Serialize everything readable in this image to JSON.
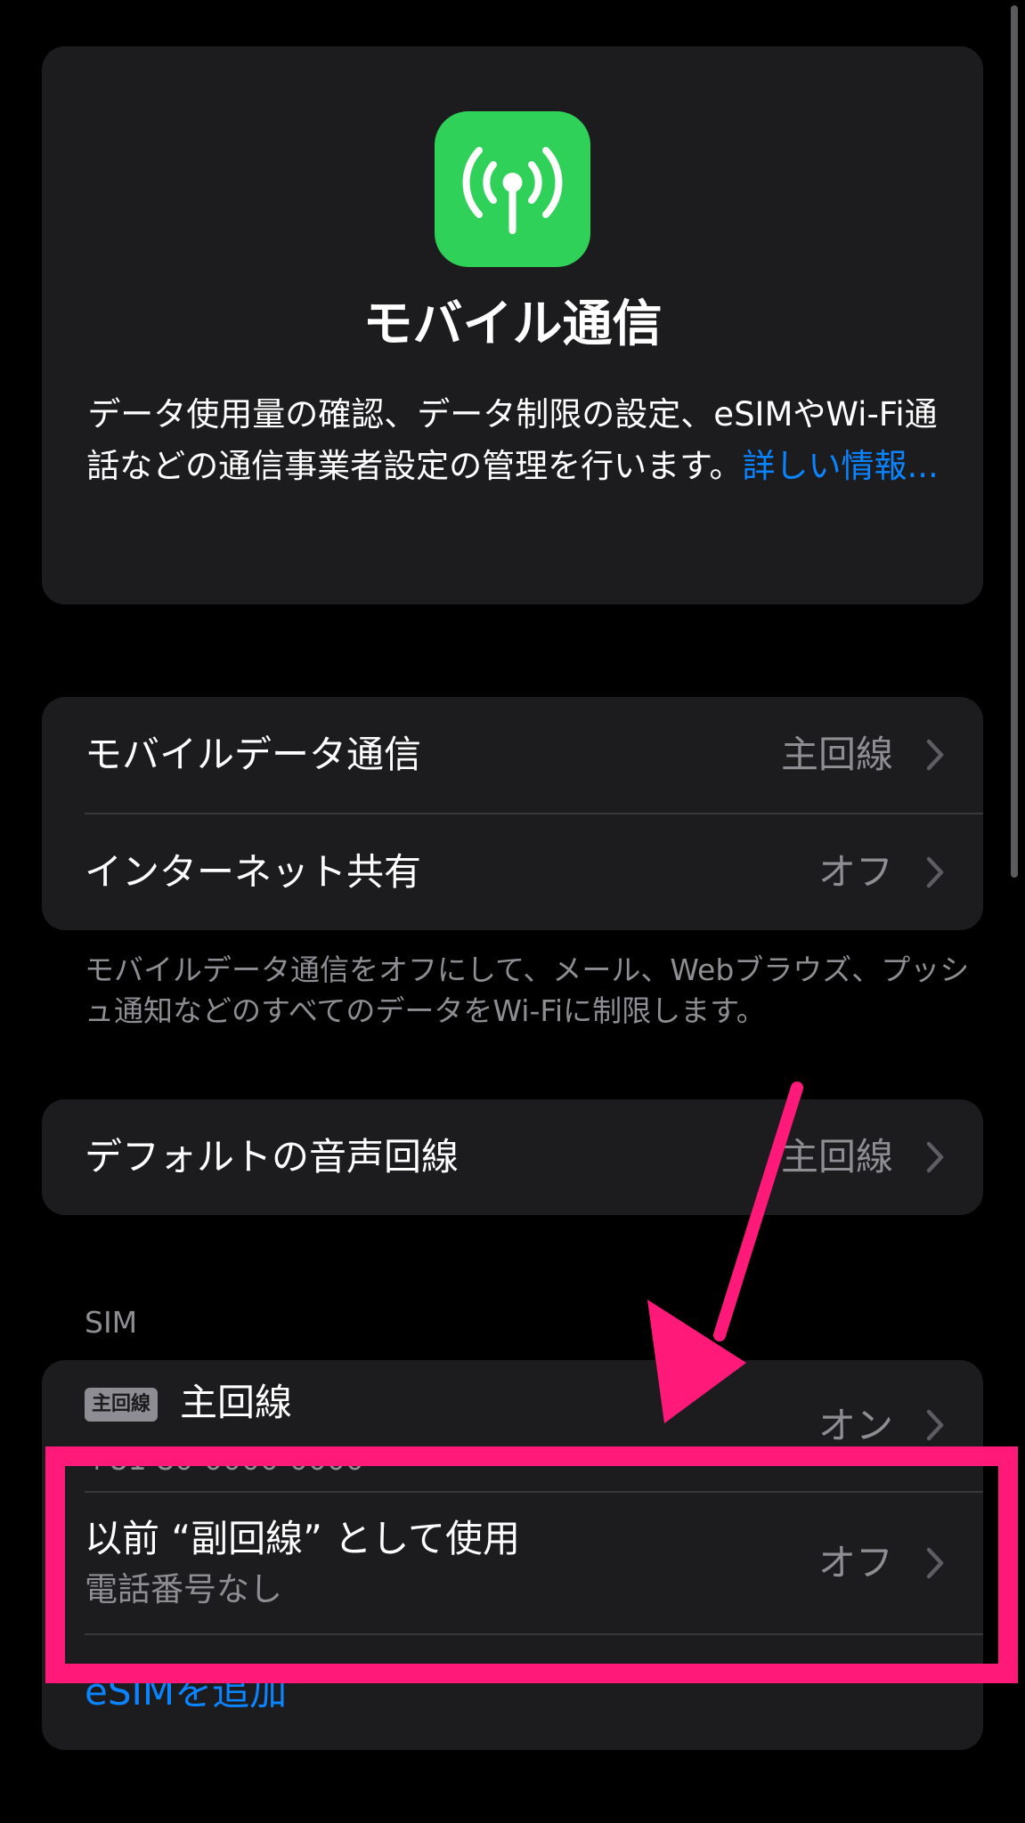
{
  "hero": {
    "icon": "antenna-icon",
    "icon_color": "#30d158",
    "title": "モバイル通信",
    "description": "データ使用量の確認、データ制限の設定、eSIMやWi-Fi通話などの通信事業者設定の管理を行います。",
    "link": "詳しい情報..."
  },
  "data_section": {
    "rows": [
      {
        "label": "モバイルデータ通信",
        "value": "主回線"
      },
      {
        "label": "インターネット共有",
        "value": "オフ"
      }
    ],
    "footer": "モバイルデータ通信をオフにして、メール、Webブラウズ、プッシュ通知などのすべてのデータをWi-Fiに制限します。"
  },
  "voice_section": {
    "label": "デフォルトの音声回線",
    "value": "主回線"
  },
  "sim_section": {
    "header": "SIM",
    "primary": {
      "badge": "主回線",
      "name": "主回線",
      "number": "+81 80-0000-0000",
      "value": "オン"
    },
    "previous": {
      "label": "以前 “副回線” として使用",
      "sublabel": "電話番号なし",
      "value": "オフ"
    },
    "add_esim": "eSIMを追加"
  },
  "annotation": {
    "color": "#ff1a7a"
  }
}
